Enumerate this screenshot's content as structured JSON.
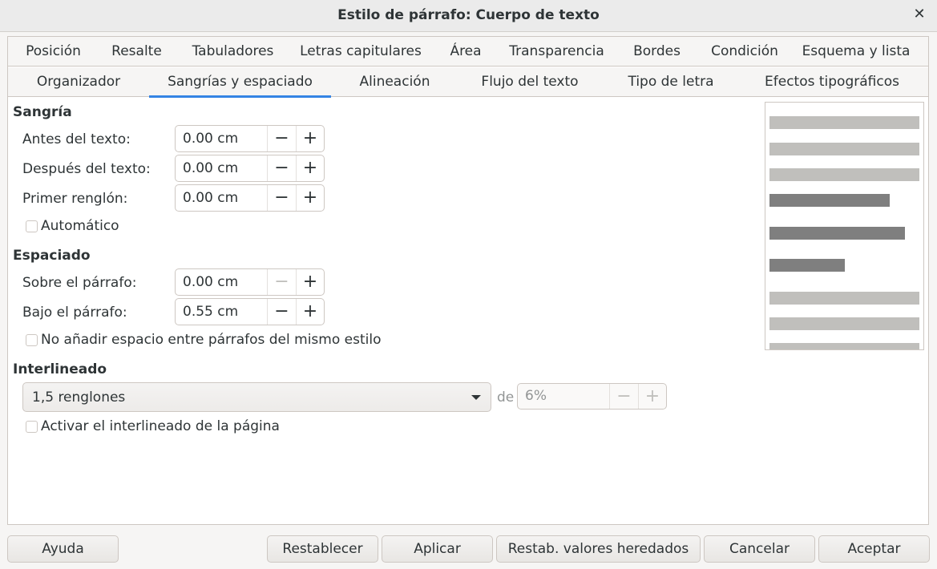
{
  "window": {
    "title": "Estilo de párrafo: Cuerpo de texto",
    "close_glyph": "✕"
  },
  "tabs_row1": [
    {
      "label": "Posición"
    },
    {
      "label": "Resalte"
    },
    {
      "label": "Tabuladores"
    },
    {
      "label": "Letras capitulares"
    },
    {
      "label": "Área"
    },
    {
      "label": "Transparencia"
    },
    {
      "label": "Bordes"
    },
    {
      "label": "Condición"
    },
    {
      "label": "Esquema y lista"
    }
  ],
  "tabs_row2": [
    {
      "label": "Organizador"
    },
    {
      "label": "Sangrías y espaciado",
      "active": true
    },
    {
      "label": "Alineación"
    },
    {
      "label": "Flujo del texto"
    },
    {
      "label": "Tipo de letra"
    },
    {
      "label": "Efectos tipográficos"
    }
  ],
  "indent": {
    "heading": "Sangría",
    "before_label": "Antes del texto:",
    "before_value": "0.00 cm",
    "after_label": "Después del texto:",
    "after_value": "0.00 cm",
    "first_line_label": "Primer renglón:",
    "first_line_value": "0.00 cm",
    "automatic_label": "Automático"
  },
  "spacing": {
    "heading": "Espaciado",
    "above_label": "Sobre el párrafo:",
    "above_value": "0.00 cm",
    "below_label": "Bajo el párrafo:",
    "below_value": "0.55 cm",
    "no_space_label": "No añadir espacio entre párrafos del mismo estilo"
  },
  "line_spacing": {
    "heading": "Interlineado",
    "selected": "1,5 renglones",
    "of_label": "de",
    "of_value": "6%",
    "page_spacing_label": "Activar el interlineado de la página"
  },
  "spin_glyphs": {
    "minus": "−",
    "plus": "+"
  },
  "footer": {
    "help": "Ayuda",
    "reset": "Restablecer",
    "apply": "Aplicar",
    "reset_inherited": "Restab. valores heredados",
    "cancel": "Cancelar",
    "ok": "Aceptar"
  },
  "colors": {
    "accent": "#3584e4",
    "preview_light": "#c0bfbc",
    "preview_dark": "#7f7f7f"
  }
}
